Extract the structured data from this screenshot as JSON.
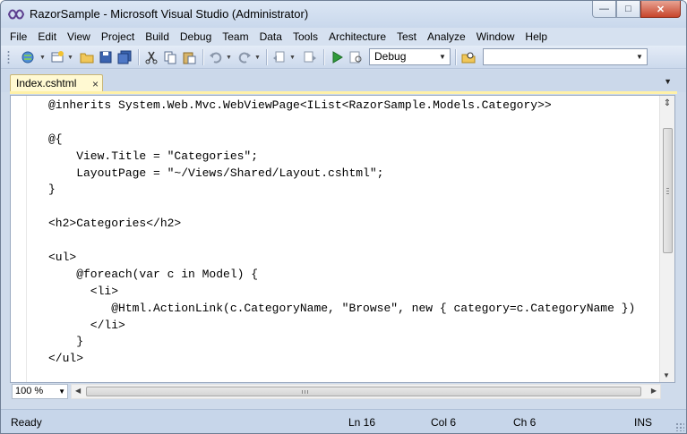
{
  "window": {
    "title": "RazorSample - Microsoft Visual Studio (Administrator)",
    "controls": {
      "minimize": "—",
      "maximize": "□",
      "close": "✕"
    }
  },
  "menubar": {
    "items": [
      "File",
      "Edit",
      "View",
      "Project",
      "Build",
      "Debug",
      "Team",
      "Data",
      "Tools",
      "Architecture",
      "Test",
      "Analyze",
      "Window",
      "Help"
    ]
  },
  "toolbar": {
    "configuration": "Debug",
    "find_value": "",
    "icons": [
      "new-project-icon",
      "add-item-icon",
      "open-file-icon",
      "save-icon",
      "save-all-icon",
      "cut-icon",
      "copy-icon",
      "paste-icon",
      "undo-icon",
      "redo-icon",
      "navigate-backward-icon",
      "navigate-forward-icon",
      "start-debugging-icon",
      "attach-icon",
      "find-in-files-icon"
    ]
  },
  "tabs": {
    "active": "Index.cshtml",
    "close_glyph": "×",
    "overflow_glyph": "▼"
  },
  "editor": {
    "lines": [
      "@inherits System.Web.Mvc.WebViewPage<IList<RazorSample.Models.Category>>",
      "",
      "@{",
      "    View.Title = \"Categories\";",
      "    LayoutPage = \"~/Views/Shared/Layout.cshtml\";",
      "}",
      "",
      "<h2>Categories</h2>",
      "",
      "<ul>",
      "    @foreach(var c in Model) {",
      "      <li>",
      "         @Html.ActionLink(c.CategoryName, \"Browse\", new { category=c.CategoryName })",
      "      </li>",
      "    }",
      "</ul>"
    ],
    "zoom": "100 %"
  },
  "status": {
    "state": "Ready",
    "line": "Ln 16",
    "col": "Col 6",
    "ch": "Ch 6",
    "mode": "INS"
  },
  "colors": {
    "chrome": "#cfdbeb",
    "tab_active": "#fff9d2",
    "status_bg": "#c7d6ea"
  }
}
